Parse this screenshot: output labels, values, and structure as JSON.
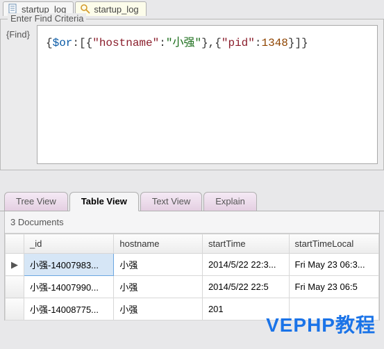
{
  "topTabs": [
    {
      "label": "startup_log",
      "icon": "doc"
    },
    {
      "label": "startup_log",
      "icon": "search"
    }
  ],
  "findCriteria": {
    "legend": "Enter Find Criteria",
    "label": "{Find}",
    "tokens": [
      {
        "t": "brace",
        "v": "{"
      },
      {
        "t": "op",
        "v": "$or"
      },
      {
        "t": "brace",
        "v": ":[{"
      },
      {
        "t": "key",
        "v": "\"hostname\""
      },
      {
        "t": "brace",
        "v": ":"
      },
      {
        "t": "str",
        "v": "\"小强\""
      },
      {
        "t": "brace",
        "v": "},{"
      },
      {
        "t": "key",
        "v": "\"pid\""
      },
      {
        "t": "brace",
        "v": ":"
      },
      {
        "t": "num",
        "v": "1348"
      },
      {
        "t": "brace",
        "v": "}]}"
      }
    ]
  },
  "viewTabs": {
    "items": [
      "Tree View",
      "Table View",
      "Text View",
      "Explain"
    ],
    "activeIndex": 1
  },
  "results": {
    "countLabel": "3 Documents",
    "columns": [
      "_id",
      "hostname",
      "startTime",
      "startTimeLocal"
    ],
    "rows": [
      {
        "_id": "小强-14007983...",
        "hostname": "小强",
        "startTime": "2014/5/22 22:3...",
        "startTimeLocal": "Fri May 23 06:3..."
      },
      {
        "_id": "小强-14007990...",
        "hostname": "小强",
        "startTime": "2014/5/22 22:5",
        "startTimeLocal": "Fri May 23 06:5"
      },
      {
        "_id": "小强-14008775...",
        "hostname": "小强",
        "startTime": "201",
        "startTimeLocal": ""
      }
    ],
    "selectedRow": 0
  },
  "watermark": "VEPHP教程"
}
